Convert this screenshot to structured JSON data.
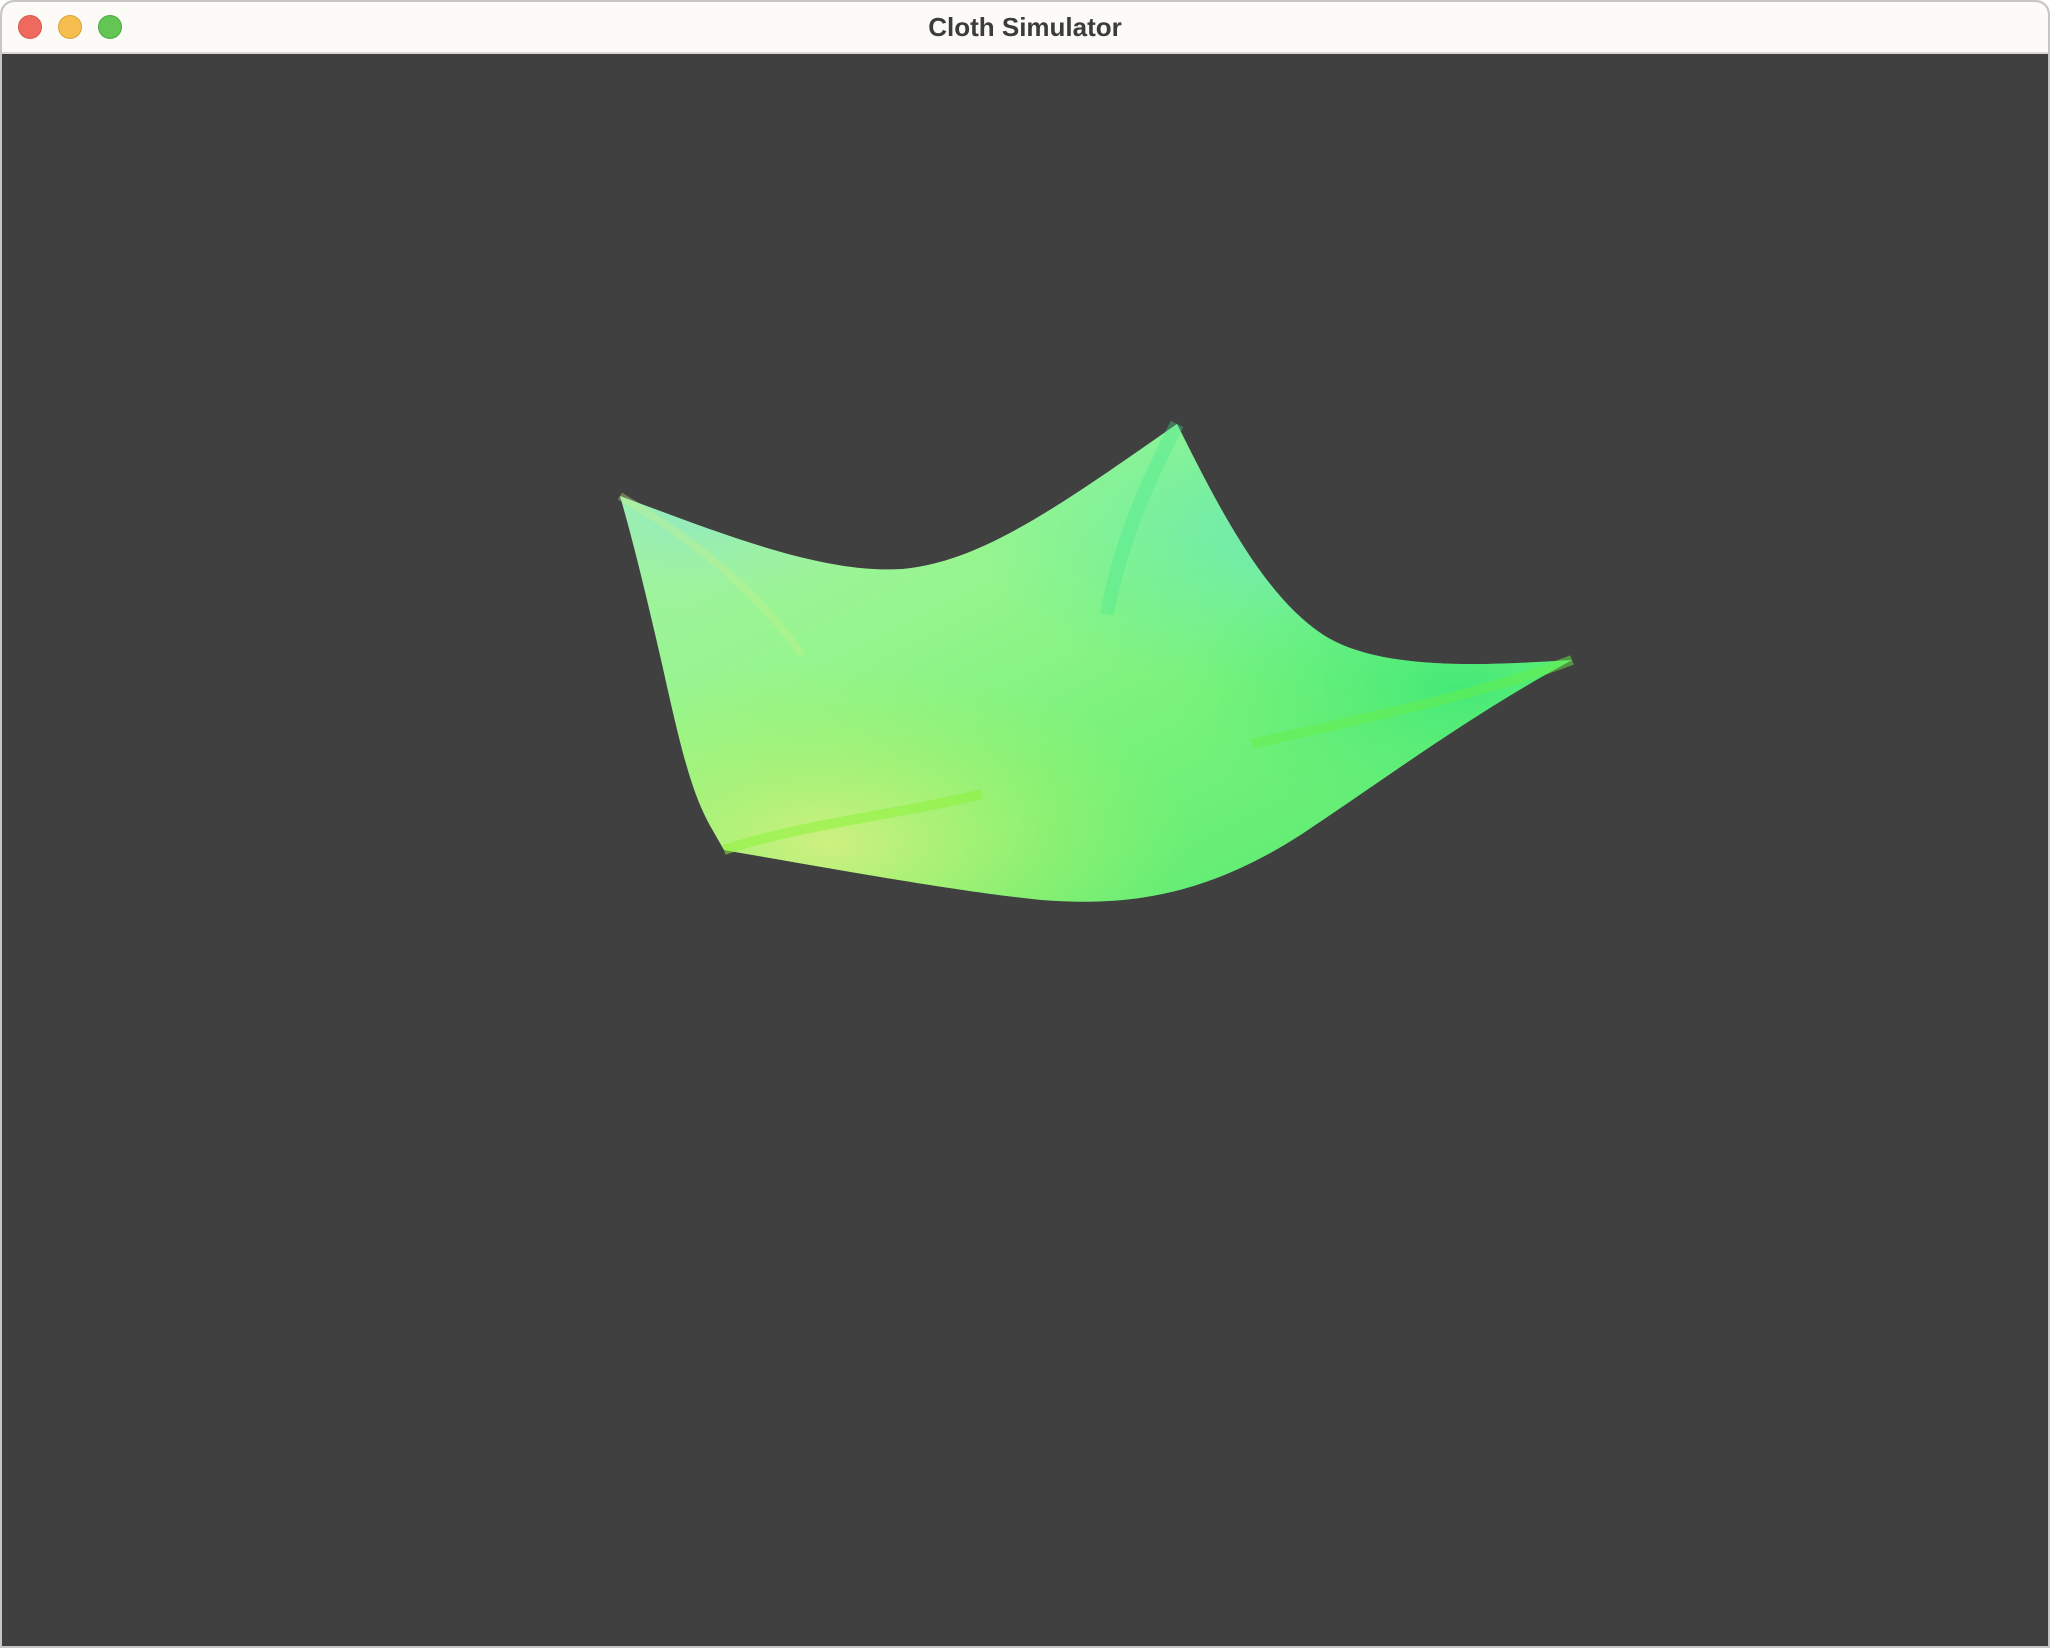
{
  "window": {
    "title": "Cloth Simulator",
    "controls": [
      "close",
      "minimize",
      "zoom"
    ]
  },
  "viewport": {
    "background_color": "#404040",
    "object": "cloth-mesh",
    "cloth_colors": [
      "#9ff59a",
      "#5cf07a",
      "#aaf25a",
      "#6ee8b0",
      "#d6f07a"
    ]
  }
}
